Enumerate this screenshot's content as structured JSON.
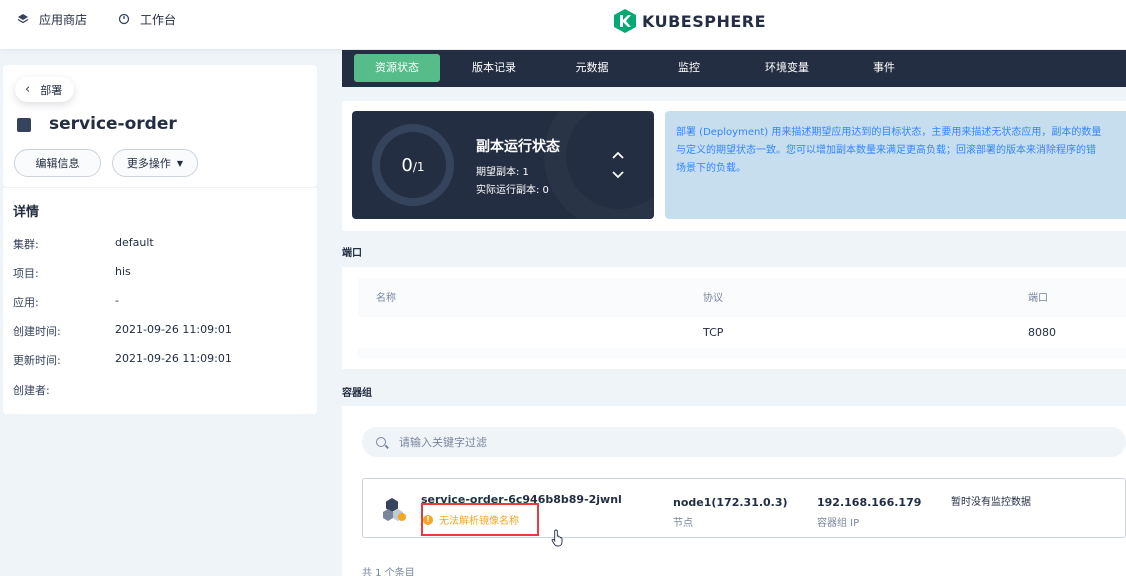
{
  "topbar": {
    "app_store": "应用商店",
    "app_store_icon": "layers-icon",
    "workbench": "工作台",
    "workbench_icon": "dashboard-icon",
    "logo_text": "KUBESPHERE",
    "logo_color": "#00aa72"
  },
  "left": {
    "back_label": "部署",
    "title": "service-order",
    "edit_label": "编辑信息",
    "more_label": "更多操作",
    "details_title": "详情",
    "details": [
      {
        "key": "集群:",
        "value": "default"
      },
      {
        "key": "项目:",
        "value": "his"
      },
      {
        "key": "应用:",
        "value": "-"
      },
      {
        "key": "创建时间:",
        "value": "2021-09-26 11:09:01"
      },
      {
        "key": "更新时间:",
        "value": "2021-09-26 11:09:01"
      },
      {
        "key": "创建者:",
        "value": ""
      }
    ]
  },
  "tabs": [
    {
      "label": "资源状态",
      "active": true
    },
    {
      "label": "版本记录",
      "active": false
    },
    {
      "label": "元数据",
      "active": false
    },
    {
      "label": "监控",
      "active": false
    },
    {
      "label": "环境变量",
      "active": false
    },
    {
      "label": "事件",
      "active": false
    }
  ],
  "status": {
    "current": "0",
    "desired": "/1",
    "title": "副本运行状态",
    "desired_line": "期望副本: 1",
    "actual_line": "实际运行副本: 0",
    "desc_lines": [
      "部署 (Deployment) 用来描述期望应用达到的目标状态，主要用来描述无状态应用，副本的数量",
      "与定义的期望状态一致。您可以增加副本数量来满足更高负载；回滚部署的版本来消除程序的错",
      "场景下的负载。"
    ]
  },
  "ports": {
    "section": "端口",
    "headers": [
      "名称",
      "协议",
      "端口"
    ],
    "rows": [
      [
        "",
        "TCP",
        "8080"
      ]
    ]
  },
  "pods": {
    "section": "容器组",
    "search_placeholder": "请输入关键字过滤",
    "items": [
      {
        "name": "service-order-6c946b8b89-2jwnl",
        "warning": "无法解析镜像名称",
        "node": "node1(172.31.0.3)",
        "node_label": "节点",
        "ip": "192.168.166.179",
        "ip_label": "容器组 IP",
        "monitor": "暂时没有监控数据"
      }
    ],
    "total": "共 1 个条目"
  },
  "colors": {
    "accent_green": "#55bc8a",
    "dark": "#242e42",
    "warning": "#f5a623",
    "highlight_border": "#e93b3b",
    "info_bg": "#c7deef",
    "info_text": "#3385ff"
  }
}
